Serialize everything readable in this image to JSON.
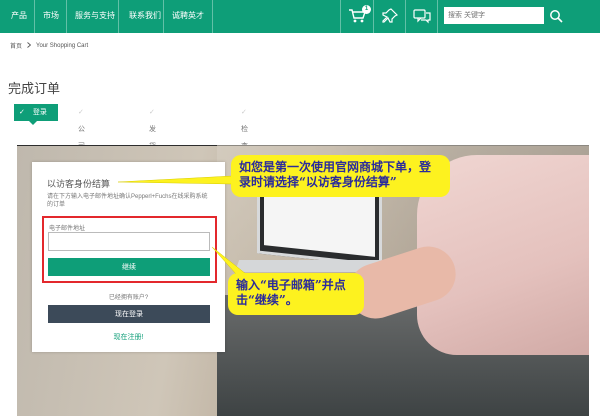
{
  "nav": {
    "items": [
      "产品",
      "市场",
      "服务与支持",
      "联系我们",
      "诚聘英才"
    ],
    "cart_count": "1",
    "search_placeholder": "搜索 关键字",
    "accent": "#0e9e78"
  },
  "breadcrumb": {
    "home": "首页",
    "current": "Your Shopping Cart"
  },
  "page_title": "完成订单",
  "steps": {
    "active": "登录",
    "items": [
      "公司开票信息",
      "发货信息",
      "检查+下单"
    ]
  },
  "guest_panel": {
    "title": "以访客身份结算",
    "description": "请在下方输入电子邮件地址确认Pepperl+Fuchs在线采购系统的订单",
    "email_label": "电子邮件地址",
    "email_value": "",
    "continue_label": "继续",
    "registered_text": "已经拥有账户?",
    "login_label": "现在登录",
    "register_label": "现在注册!"
  },
  "annotations": {
    "callout_1": "如您是第一次使用官网商城下单，登录时请选择“以访客身份结算”",
    "callout_2": "输入“电子邮箱”并点击“继续”。",
    "highlight_color": "#e3282c",
    "callout_color": "#fdf21f"
  },
  "icons": [
    "cart-icon",
    "pin-icon",
    "chat-icon",
    "search-icon",
    "check-icon",
    "chevron-right-icon"
  ]
}
